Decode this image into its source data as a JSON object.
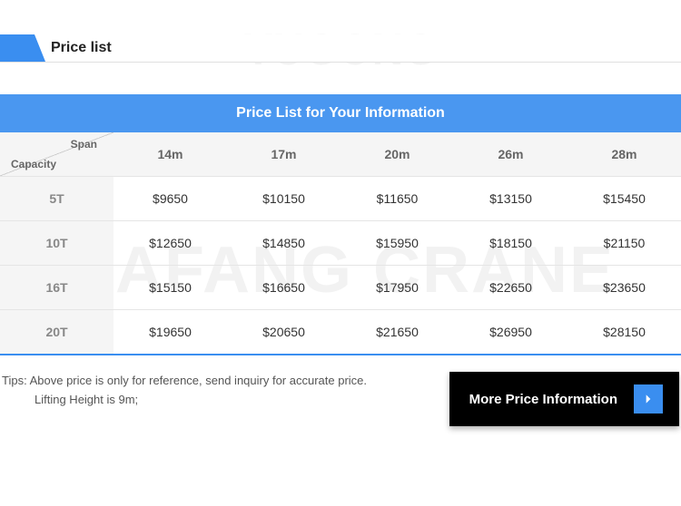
{
  "section_title": "Price list",
  "table_title": "Price List for Your Information",
  "corner": {
    "span": "Span",
    "capacity": "Capacity"
  },
  "spans": [
    "14m",
    "17m",
    "20m",
    "26m",
    "28m"
  ],
  "rows": [
    {
      "capacity": "5T",
      "prices": [
        "$9650",
        "$10150",
        "$11650",
        "$13150",
        "$15450"
      ]
    },
    {
      "capacity": "10T",
      "prices": [
        "$12650",
        "$14850",
        "$15950",
        "$18150",
        "$21150"
      ]
    },
    {
      "capacity": "16T",
      "prices": [
        "$15150",
        "$16650",
        "$17950",
        "$22650",
        "$23650"
      ]
    },
    {
      "capacity": "20T",
      "prices": [
        "$19650",
        "$20650",
        "$21650",
        "$26950",
        "$28150"
      ]
    }
  ],
  "tips_label": "Tips:",
  "tips_line1": "Above price is only for reference, send inquiry for accurate price.",
  "tips_line2": "Lifting Height is 9m;",
  "more_button": "More Price Information",
  "watermark": "DAFANG CRANE",
  "watermark_top": "YUGONG"
}
